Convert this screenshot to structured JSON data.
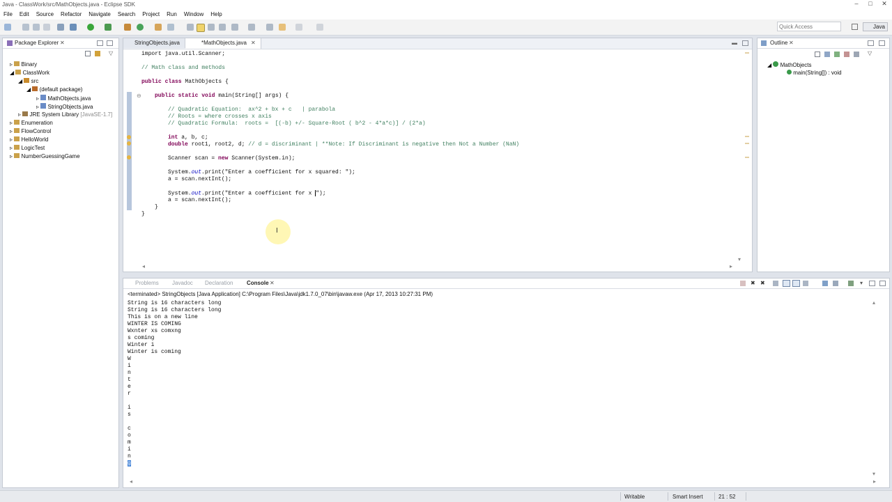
{
  "window": {
    "title": "Java - ClassWork/src/MathObjects.java - Eclipse SDK"
  },
  "menu": [
    "File",
    "Edit",
    "Source",
    "Refactor",
    "Navigate",
    "Search",
    "Project",
    "Run",
    "Window",
    "Help"
  ],
  "toolbar": {
    "quick_access_placeholder": "Quick Access",
    "perspective": "Java"
  },
  "package_explorer": {
    "title": "Package Explorer",
    "items": [
      {
        "label": "Binary"
      },
      {
        "label": "ClassWork"
      },
      {
        "label": "src"
      },
      {
        "label": "(default package)"
      },
      {
        "label": "MathObjects.java"
      },
      {
        "label": "StringObjects.java"
      },
      {
        "label": "JRE System Library",
        "extra": "[JavaSE-1.7]"
      },
      {
        "label": "Enumeration"
      },
      {
        "label": "FlowControl"
      },
      {
        "label": "HelloWorld"
      },
      {
        "label": "LogicTest"
      },
      {
        "label": "NumberGuessingGame"
      }
    ]
  },
  "editor": {
    "tabs": [
      "StringObjects.java",
      "*MathObjects.java"
    ],
    "lines": {
      "l1": "import java.util.Scanner;",
      "l2": "// Math class and methods",
      "l3a": "public class",
      "l3b": " MathObjects {",
      "l4a": "public static void",
      "l4b": " main(String[] args) {",
      "l5": "// Quadratic Equation:  ax^2 + bx + c   | parabola",
      "l6": "// Roots = where crosses x axis",
      "l7": "// Quadratic Formula:  roots =  [(-b) +/- Square-Root ( b^2 - 4*a*c)] / (2*a)",
      "l8a": "int",
      "l8b": " a, b, c;",
      "l9a": "double",
      "l9b": " root1, root2, d; ",
      "l9c": "// d = discriminant | **Note: If Discriminant is negative then Not a Number (NaN)",
      "l10a": "Scanner scan = ",
      "l10b": "new",
      "l10c": " Scanner(System.in);",
      "l11a": "System.",
      "l11b": "out",
      "l11c": ".print(\"Enter a coefficient for x squared: \");",
      "l12": "a = scan.nextInt();",
      "l13a": "System.",
      "l13b": "out",
      "l13c": ".print(\"Enter a coefficient for x ",
      "l13d": "\");",
      "l14": "a = scan.nextInt();",
      "l15": "}",
      "l16": "}"
    }
  },
  "outline": {
    "title": "Outline",
    "class": "MathObjects",
    "method": "main(String[]) : void"
  },
  "bottom_tabs": [
    "Problems",
    "Javadoc",
    "Declaration",
    "Console"
  ],
  "console": {
    "header": "<terminated> StringObjects [Java Application] C:\\Program Files\\Java\\jdk1.7.0_07\\bin\\javaw.exe (Apr 17, 2013 10:27:31 PM)",
    "lines": [
      "String is 16 characters long",
      "String is 16 characters long",
      "This is on a new line",
      "WINTER IS COMING",
      "Wxnter xs comxng",
      "s coming",
      "Winter i",
      "Winter is coming",
      "W",
      "i",
      "n",
      "t",
      "e",
      "r",
      "",
      "i",
      "s",
      "",
      "c",
      "o",
      "m",
      "i",
      "n",
      "g"
    ]
  },
  "status": {
    "writable": "Writable",
    "insert": "Smart Insert",
    "position": "21 : 52"
  }
}
